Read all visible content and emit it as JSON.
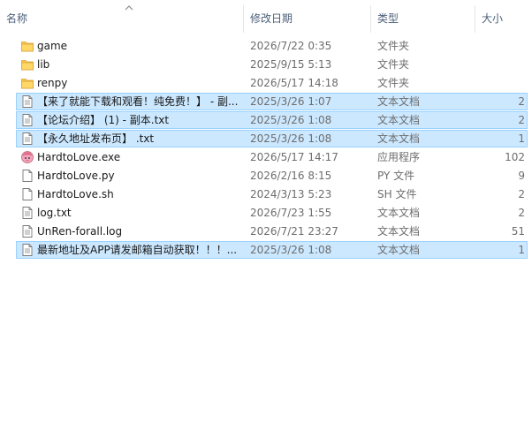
{
  "columns": {
    "name": "名称",
    "date": "修改日期",
    "type": "类型",
    "size": "大小"
  },
  "files": [
    {
      "name": "game",
      "date": "2026/7/22 0:35",
      "type": "文件夹",
      "size": "",
      "icon": "folder-icon",
      "selected": false
    },
    {
      "name": "lib",
      "date": "2025/9/15 5:13",
      "type": "文件夹",
      "size": "",
      "icon": "folder-icon",
      "selected": false
    },
    {
      "name": "renpy",
      "date": "2026/5/17 14:18",
      "type": "文件夹",
      "size": "",
      "icon": "folder-icon",
      "selected": false
    },
    {
      "name": "【来了就能下载和观看！纯免费！】 - 副...",
      "date": "2025/3/26 1:07",
      "type": "文本文档",
      "size": "2",
      "icon": "text-file-icon",
      "selected": true
    },
    {
      "name": "【论坛介绍】 (1) - 副本.txt",
      "date": "2025/3/26 1:08",
      "type": "文本文档",
      "size": "2",
      "icon": "text-file-icon",
      "selected": true
    },
    {
      "name": "【永久地址发布页】 .txt",
      "date": "2025/3/26 1:08",
      "type": "文本文档",
      "size": "1",
      "icon": "text-file-icon",
      "selected": true
    },
    {
      "name": "HardtoLove.exe",
      "date": "2026/5/17 14:17",
      "type": "应用程序",
      "size": "102",
      "icon": "app-icon",
      "selected": false
    },
    {
      "name": "HardtoLove.py",
      "date": "2026/2/16 8:15",
      "type": "PY 文件",
      "size": "9",
      "icon": "blank-file-icon",
      "selected": false
    },
    {
      "name": "HardtoLove.sh",
      "date": "2024/3/13 5:23",
      "type": "SH 文件",
      "size": "2",
      "icon": "blank-file-icon",
      "selected": false
    },
    {
      "name": "log.txt",
      "date": "2026/7/23 1:55",
      "type": "文本文档",
      "size": "2",
      "icon": "text-file-icon",
      "selected": false
    },
    {
      "name": "UnRen-forall.log",
      "date": "2026/7/21 23:27",
      "type": "文本文档",
      "size": "51",
      "icon": "text-file-icon",
      "selected": false
    },
    {
      "name": "最新地址及APP请发邮箱自动获取！！！...",
      "date": "2025/3/26 1:08",
      "type": "文本文档",
      "size": "1",
      "icon": "text-file-icon",
      "selected": true
    }
  ],
  "colors": {
    "selected_bg": "#cce8ff",
    "selected_border": "#99d1ff",
    "header_text": "#4c607a",
    "folder_yellow": "#f8c74a"
  }
}
